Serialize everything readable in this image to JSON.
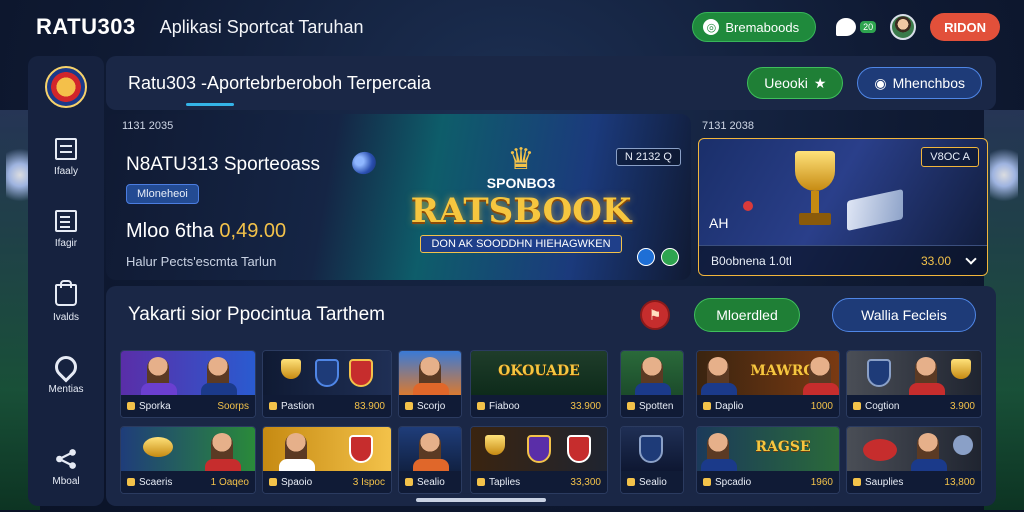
{
  "topbar": {
    "brand": "RATU303",
    "tagline": "Aplikasi Sportcat Taruhan",
    "green_pill": "Bremaboods",
    "green_pill_icon": "app-icon",
    "chat_badge": "20",
    "signup": "RIDON"
  },
  "sidebar": {
    "items": [
      {
        "label": "Ifaaly",
        "icon": "list-icon"
      },
      {
        "label": "Ifagir",
        "icon": "document-icon"
      },
      {
        "label": "Ivalds",
        "icon": "bag-icon"
      },
      {
        "label": "Mentias",
        "icon": "location-pin-icon"
      },
      {
        "label": "Mboal",
        "icon": "share-icon"
      }
    ]
  },
  "header": {
    "title": "Ratu303 -Aportebrberoboh Terpercaia",
    "btn_green": "Ueooki",
    "btn_blue": "Mhenchbos"
  },
  "hero": {
    "left_date": "1131 2035",
    "title": "N8ATU313 Sporteoass",
    "chip": "Mloneheoi",
    "price_prefix": "Mloo 6tha ",
    "price_value": "0,49.00",
    "subtitle": "Halur Pects'escmta Tarlun",
    "date_badge": "N 2132 Q",
    "logo_top": "SPONBO3",
    "logo_brand": "RATSBOOK",
    "logo_ribbon": "DON AK SOODDHN HIEHAGWKEN",
    "right_date": "7131 2038",
    "right_badge": "V8OC A",
    "right_code": "AH",
    "right_footer_label": "B0obnena 1.0tl",
    "right_footer_amount": "33.00"
  },
  "lower": {
    "title": "Yakarti sior Ppocintua Tarthem",
    "red_icon": "soccer-player-icon",
    "btn_green": "Mloerdled",
    "btn_blue": "Wallia Fecleis"
  },
  "cards": [
    {
      "label": "Sporka",
      "amount": "Soorps"
    },
    {
      "label": "Pastion",
      "amount": "83.900"
    },
    {
      "label": "Scorjo",
      "amount": ""
    },
    {
      "label": "Fiaboo",
      "amount": "33.900"
    },
    {
      "label": "Spotten",
      "amount": ""
    },
    {
      "label": "Daplio",
      "amount": "1000"
    },
    {
      "label": "Cogtion",
      "amount": "3.900"
    },
    {
      "label": "Scaeris",
      "amount": "1 Oaqeo"
    },
    {
      "label": "Spaoio",
      "amount": "3 Ispoc"
    },
    {
      "label": "Sealio",
      "amount": ""
    },
    {
      "label": "Taplies",
      "amount": "33,300"
    },
    {
      "label": "Sealio",
      "amount": ""
    },
    {
      "label": "Spcadio",
      "amount": "1960"
    },
    {
      "label": "Sauplies",
      "amount": "13,800"
    }
  ],
  "cards_top_words": {
    "card3": "OKOUADE",
    "card6": "MAWRO",
    "card12": "RAGSE"
  },
  "colors": {
    "accent_green": "#1f8a3c",
    "accent_blue": "#1e3b78",
    "accent_red": "#e2503a",
    "gold": "#f3c24a",
    "panel": "#1a2746"
  }
}
